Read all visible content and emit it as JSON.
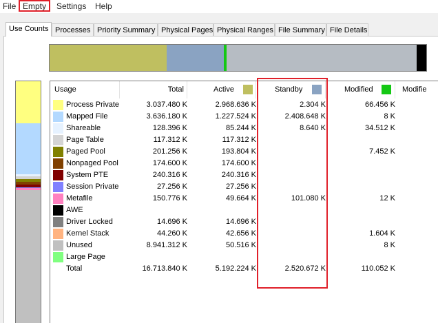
{
  "menu": {
    "items": [
      "File",
      "Empty",
      "Settings",
      "Help"
    ]
  },
  "tabs": [
    "Use Counts",
    "Processes",
    "Priority Summary",
    "Physical Pages",
    "Physical Ranges",
    "File Summary",
    "File Details"
  ],
  "columns": {
    "usage": "Usage",
    "total": "Total",
    "active": "Active",
    "standby": "Standby",
    "modified": "Modified",
    "modified_no_write": "Modifie"
  },
  "header_colors": {
    "active": "#bfbf60",
    "standby": "#8aa3c2",
    "modified": "#14c814"
  },
  "rows": [
    {
      "usage": "Process Private",
      "color": "#ffff80",
      "total": "3.037.480 K",
      "active": "2.968.636 K",
      "standby": "2.304 K",
      "modified": "66.456 K"
    },
    {
      "usage": "Mapped File",
      "color": "#b3d9ff",
      "total": "3.636.180 K",
      "active": "1.227.524 K",
      "standby": "2.408.648 K",
      "modified": "8 K"
    },
    {
      "usage": "Shareable",
      "color": "#e6f2ff",
      "total": "128.396 K",
      "active": "85.244 K",
      "standby": "8.640 K",
      "modified": "34.512 K"
    },
    {
      "usage": "Page Table",
      "color": "#d4d4d4",
      "total": "117.312 K",
      "active": "117.312 K",
      "standby": "",
      "modified": ""
    },
    {
      "usage": "Paged Pool",
      "color": "#808000",
      "total": "201.256 K",
      "active": "193.804 K",
      "standby": "",
      "modified": "7.452 K"
    },
    {
      "usage": "Nonpaged Pool",
      "color": "#804000",
      "total": "174.600 K",
      "active": "174.600 K",
      "standby": "",
      "modified": ""
    },
    {
      "usage": "System PTE",
      "color": "#800000",
      "total": "240.316 K",
      "active": "240.316 K",
      "standby": "",
      "modified": ""
    },
    {
      "usage": "Session Private",
      "color": "#8080ff",
      "total": "27.256 K",
      "active": "27.256 K",
      "standby": "",
      "modified": ""
    },
    {
      "usage": "Metafile",
      "color": "#ff80c0",
      "total": "150.776 K",
      "active": "49.664 K",
      "standby": "101.080 K",
      "modified": "12 K"
    },
    {
      "usage": "AWE",
      "color": "#000000",
      "total": "",
      "active": "",
      "standby": "",
      "modified": ""
    },
    {
      "usage": "Driver Locked",
      "color": "#808080",
      "total": "14.696 K",
      "active": "14.696 K",
      "standby": "",
      "modified": ""
    },
    {
      "usage": "Kernel Stack",
      "color": "#ffb380",
      "total": "44.260 K",
      "active": "42.656 K",
      "standby": "",
      "modified": "1.604 K"
    },
    {
      "usage": "Unused",
      "color": "#c0c0c0",
      "total": "8.941.312 K",
      "active": "50.516 K",
      "standby": "",
      "modified": "8 K"
    },
    {
      "usage": "Large Page",
      "color": "#80ff80",
      "total": "",
      "active": "",
      "standby": "",
      "modified": ""
    },
    {
      "usage": "Total",
      "color": "",
      "total": "16.713.840 K",
      "active": "5.192.224 K",
      "standby": "2.520.672 K",
      "modified": "110.052 K"
    }
  ],
  "top_bar_segments": [
    {
      "name": "active",
      "fraction": 0.311,
      "color": "#bfbf60"
    },
    {
      "name": "standby",
      "fraction": 0.151,
      "color": "#8aa3c2"
    },
    {
      "name": "modified",
      "fraction": 0.007,
      "color": "#14c814"
    },
    {
      "name": "free",
      "fraction": 0.505,
      "color": "#b6bcc3"
    },
    {
      "name": "bad",
      "fraction": 0.026,
      "color": "#000000"
    }
  ],
  "left_bar_segments": [
    {
      "name": "process-private",
      "fraction": 0.175,
      "color": "#ffff80"
    },
    {
      "name": "mapped-file",
      "fraction": 0.211,
      "color": "#b3d9ff"
    },
    {
      "name": "shareable",
      "fraction": 0.008,
      "color": "#e6f2ff"
    },
    {
      "name": "page-table",
      "fraction": 0.011,
      "color": "#d4d4d4"
    },
    {
      "name": "paged-pool",
      "fraction": 0.011,
      "color": "#808000"
    },
    {
      "name": "nonpaged-pool",
      "fraction": 0.011,
      "color": "#804000"
    },
    {
      "name": "system-pte",
      "fraction": 0.011,
      "color": "#800000"
    },
    {
      "name": "session-private",
      "fraction": 0.003,
      "color": "#8080ff"
    },
    {
      "name": "metafile",
      "fraction": 0.009,
      "color": "#ff80c0"
    },
    {
      "name": "unused",
      "fraction": 0.55,
      "color": "#c0c0c0"
    }
  ]
}
